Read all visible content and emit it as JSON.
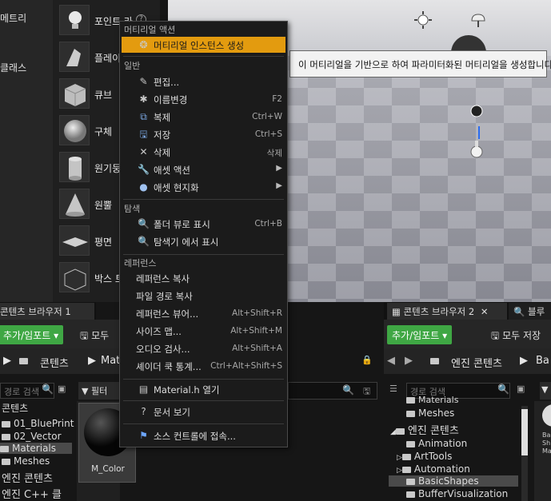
{
  "left_panel": {
    "categories": [
      "메트리",
      "클래스"
    ]
  },
  "actors": [
    {
      "label": "포인트 라"
    },
    {
      "label": "플레이"
    },
    {
      "label": "큐브"
    },
    {
      "label": "구체"
    },
    {
      "label": "원기둥"
    },
    {
      "label": "원뿔"
    },
    {
      "label": "평면"
    },
    {
      "label": "박스 트"
    }
  ],
  "context_menu": {
    "sections": [
      {
        "header": "머티리얼 액션"
      },
      {
        "header": "일반"
      },
      {
        "header": "탐색"
      },
      {
        "header": "레퍼런스"
      }
    ],
    "items": [
      {
        "label": "머티리얼 인스턴스 생성",
        "icon": "instance-icon",
        "shortcut": ""
      },
      {
        "label": "편집...",
        "icon": "edit-icon",
        "shortcut": ""
      },
      {
        "label": "이름변경",
        "icon": "rename-icon",
        "shortcut": "F2"
      },
      {
        "label": "복제",
        "icon": "duplicate-icon",
        "shortcut": "Ctrl+W"
      },
      {
        "label": "저장",
        "icon": "save-icon",
        "shortcut": "Ctrl+S"
      },
      {
        "label": "삭제",
        "icon": "delete-icon",
        "shortcut": "삭제"
      },
      {
        "label": "애셋 액션",
        "icon": "wrench-icon",
        "shortcut": ""
      },
      {
        "label": "애셋 현지화",
        "icon": "globe-icon",
        "shortcut": ""
      },
      {
        "label": "폴더 뷰로 표시",
        "icon": "find-folder-icon",
        "shortcut": "Ctrl+B"
      },
      {
        "label": "탐색기 에서 표시",
        "icon": "explorer-icon",
        "shortcut": ""
      },
      {
        "label": "레퍼런스 복사",
        "icon": "",
        "shortcut": ""
      },
      {
        "label": "파일 경로 복사",
        "icon": "",
        "shortcut": ""
      },
      {
        "label": "레퍼런스 뷰어...",
        "icon": "",
        "shortcut": "Alt+Shift+R"
      },
      {
        "label": "사이즈 맵...",
        "icon": "",
        "shortcut": "Alt+Shift+M"
      },
      {
        "label": "오디오 검사...",
        "icon": "",
        "shortcut": "Alt+Shift+A"
      },
      {
        "label": "셰이더 쿡 통계...",
        "icon": "",
        "shortcut": "Ctrl+Alt+Shift+S"
      },
      {
        "label": "Material.h 열기",
        "icon": "code-icon",
        "shortcut": ""
      },
      {
        "label": "문서 보기",
        "icon": "help-icon",
        "shortcut": ""
      },
      {
        "label": "소스 컨트롤에 접속...",
        "icon": "source-control-icon",
        "shortcut": ""
      }
    ]
  },
  "tooltip": "이 머티리얼을 기반으로 하여 파라미터화된 머티리얼을 생성합니다.",
  "browser1": {
    "tab": "콘텐츠 브라우저 1",
    "add_import": "추가/임포트",
    "save_all": "모두",
    "path_root": "콘텐츠",
    "path_child": "Mat",
    "search_placeholder": "경로 검색",
    "filter": "필터",
    "tree": [
      "콘텐츠",
      "01_BluePrint",
      "02_Vector",
      "Materials",
      "Meshes",
      "엔진 콘텐츠",
      "엔진 C++ 클"
    ],
    "asset_name": "M_Color"
  },
  "browser2": {
    "tab": "콘텐츠 브라우저 2",
    "tab_next": "블루",
    "add_import": "추가/임포트",
    "save_all": "모두 저장",
    "path_root": "엔진 콘텐츠",
    "path_child": "Ba",
    "search_placeholder": "경로 검색",
    "tree": [
      "Materials",
      "Meshes",
      "엔진 콘텐츠",
      "Animation",
      "ArtTools",
      "Automation",
      "BasicShapes",
      "BufferVisualization"
    ],
    "asset_cut": [
      "Ba",
      "Sh",
      "Mat"
    ]
  },
  "colors": {
    "highlight": "#e39b0f",
    "green_button": "#3fa744",
    "menu_bg": "#1b1b1b"
  }
}
